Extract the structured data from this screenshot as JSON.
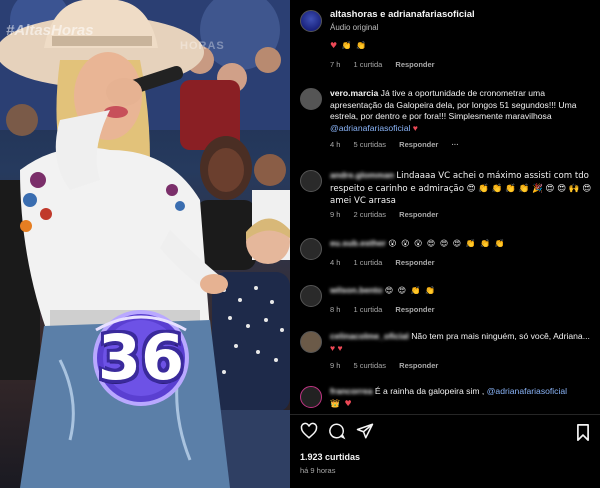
{
  "video": {
    "watermark": "#AltasHoras",
    "watermark2": "HORAS",
    "badge_number": "36"
  },
  "post": {
    "author_line": "altashoras e adrianafariasoficial",
    "audio": "Áudio original"
  },
  "comments": [
    {
      "user": "",
      "text": "♥ 👏 👏",
      "time": "7 h",
      "likes": "1 curtida",
      "reply": "Responder"
    },
    {
      "user": "vero.marcia",
      "text": "Já tive a oportunidade de cronometrar uma apresentação da Galopeira dela, por longos 51 segundos!!! Uma estrela, por dentro e por fora!!! Simplesmente maravilhosa",
      "mention": "@adrianafariasoficial",
      "suffix": "♥",
      "time": "4 h",
      "likes": "5 curtidas",
      "reply": "Responder",
      "more": "···"
    },
    {
      "user": "andre.glomman",
      "text": "Lindaaaa VC achei o máximo assisti com tdo respeito e carinho e admiração 😍 👏 👏 👏 👏 🎉 😍 😍 🙌 😍 amei VC arrasa",
      "time": "9 h",
      "likes": "2 curtidas",
      "reply": "Responder"
    },
    {
      "user": "eu.sub.esther",
      "text": "😮 😮 😮 😍 😍 😍 👏 👏 👏",
      "time": "4 h",
      "likes": "1 curtida",
      "reply": "Responder"
    },
    {
      "user": "wilson.bento",
      "text": "😍 😍 👏 👏",
      "time": "8 h",
      "likes": "1 curtida",
      "reply": "Responder"
    },
    {
      "user": "celinacolme_oficial",
      "text": "Não tem pra mais ninguém, só você, Adriana...",
      "suffix": "♥ ♥",
      "time": "9 h",
      "likes": "5 curtidas",
      "reply": "Responder"
    },
    {
      "user": "francorrea",
      "text": "É a rainha da galopeira sim ,",
      "mention": "@adrianafariasoficial",
      "suffix": "👑 ♥"
    }
  ],
  "footer": {
    "likes": "1.923 curtidas",
    "time_ago": "há 9 horas"
  },
  "icons": {
    "like": "heart-outline-icon",
    "comment": "comment-bubble-icon",
    "share": "paper-plane-icon",
    "save": "bookmark-icon"
  },
  "colors": {
    "mention": "#8ab4f8",
    "heart": "#ed4956",
    "badge": "#3a2a9c"
  }
}
